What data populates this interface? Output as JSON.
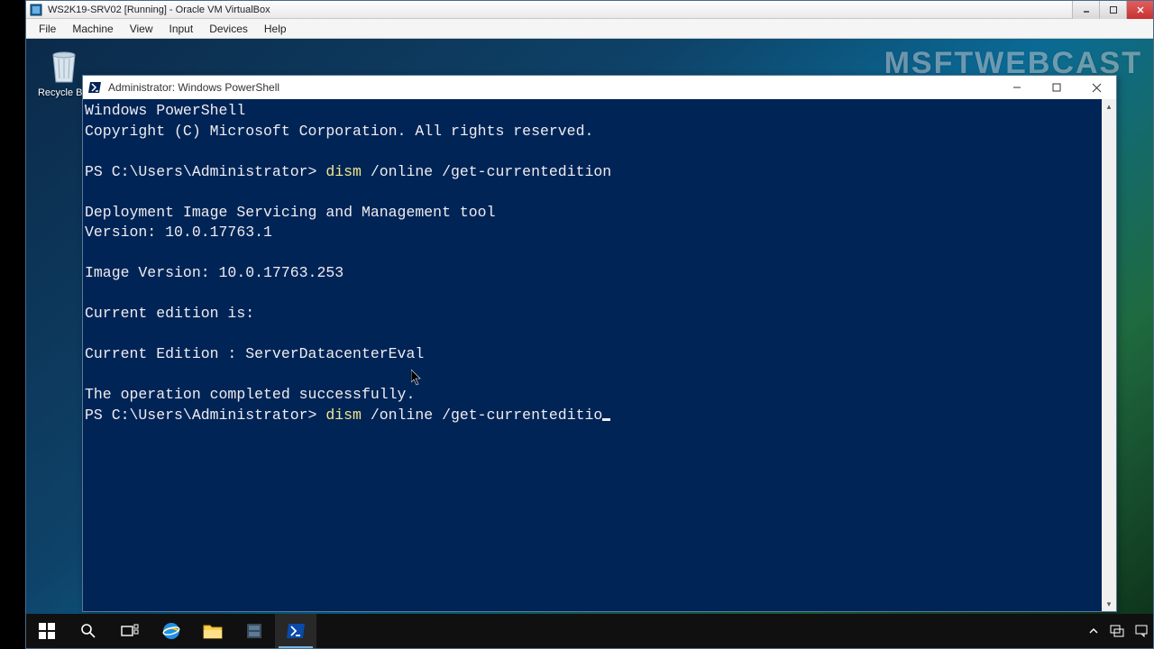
{
  "vbox": {
    "title": "WS2K19-SRV02 [Running] - Oracle VM VirtualBox",
    "menu": {
      "file": "File",
      "machine": "Machine",
      "view": "View",
      "input": "Input",
      "devices": "Devices",
      "help": "Help"
    }
  },
  "desktop": {
    "recycle_bin": "Recycle Bin",
    "watermark": "MSFTWEBCAST"
  },
  "ps_window": {
    "title": "Administrator: Windows PowerShell"
  },
  "terminal": {
    "banner1": "Windows PowerShell",
    "banner2": "Copyright (C) Microsoft Corporation. All rights reserved.",
    "prompt": "PS C:\\Users\\Administrator> ",
    "cmd_word": "dism",
    "cmd_args1": " /online /get-currentedition",
    "out1": "Deployment Image Servicing and Management tool",
    "out2": "Version: 10.0.17763.1",
    "out3": "Image Version: 10.0.17763.253",
    "out4": "Current edition is:",
    "out5": "Current Edition : ServerDatacenterEval",
    "out6": "The operation completed successfully.",
    "cmd_args2": " /online /get-currenteditio"
  }
}
